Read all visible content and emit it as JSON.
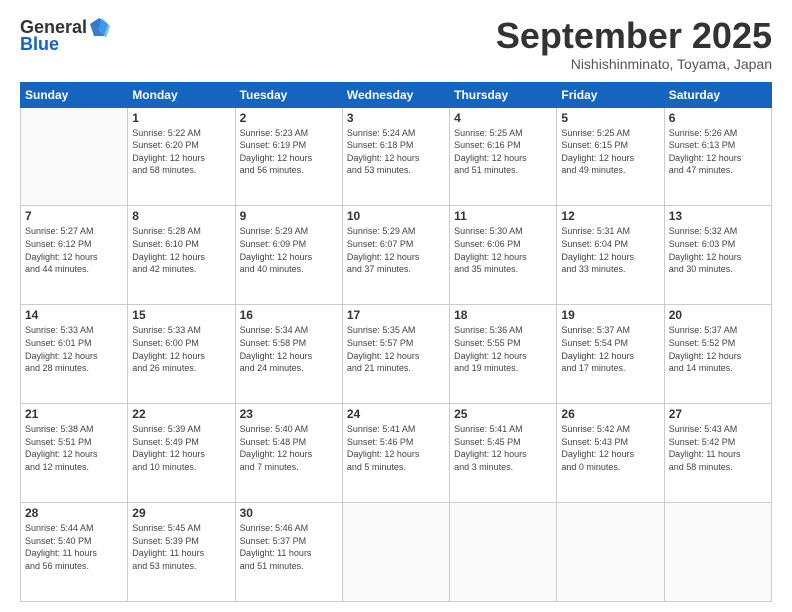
{
  "header": {
    "logo_line1": "General",
    "logo_line2": "Blue",
    "month": "September 2025",
    "location": "Nishishinminato, Toyama, Japan"
  },
  "weekdays": [
    "Sunday",
    "Monday",
    "Tuesday",
    "Wednesday",
    "Thursday",
    "Friday",
    "Saturday"
  ],
  "weeks": [
    [
      {
        "day": "",
        "info": ""
      },
      {
        "day": "1",
        "info": "Sunrise: 5:22 AM\nSunset: 6:20 PM\nDaylight: 12 hours\nand 58 minutes."
      },
      {
        "day": "2",
        "info": "Sunrise: 5:23 AM\nSunset: 6:19 PM\nDaylight: 12 hours\nand 56 minutes."
      },
      {
        "day": "3",
        "info": "Sunrise: 5:24 AM\nSunset: 6:18 PM\nDaylight: 12 hours\nand 53 minutes."
      },
      {
        "day": "4",
        "info": "Sunrise: 5:25 AM\nSunset: 6:16 PM\nDaylight: 12 hours\nand 51 minutes."
      },
      {
        "day": "5",
        "info": "Sunrise: 5:25 AM\nSunset: 6:15 PM\nDaylight: 12 hours\nand 49 minutes."
      },
      {
        "day": "6",
        "info": "Sunrise: 5:26 AM\nSunset: 6:13 PM\nDaylight: 12 hours\nand 47 minutes."
      }
    ],
    [
      {
        "day": "7",
        "info": "Sunrise: 5:27 AM\nSunset: 6:12 PM\nDaylight: 12 hours\nand 44 minutes."
      },
      {
        "day": "8",
        "info": "Sunrise: 5:28 AM\nSunset: 6:10 PM\nDaylight: 12 hours\nand 42 minutes."
      },
      {
        "day": "9",
        "info": "Sunrise: 5:29 AM\nSunset: 6:09 PM\nDaylight: 12 hours\nand 40 minutes."
      },
      {
        "day": "10",
        "info": "Sunrise: 5:29 AM\nSunset: 6:07 PM\nDaylight: 12 hours\nand 37 minutes."
      },
      {
        "day": "11",
        "info": "Sunrise: 5:30 AM\nSunset: 6:06 PM\nDaylight: 12 hours\nand 35 minutes."
      },
      {
        "day": "12",
        "info": "Sunrise: 5:31 AM\nSunset: 6:04 PM\nDaylight: 12 hours\nand 33 minutes."
      },
      {
        "day": "13",
        "info": "Sunrise: 5:32 AM\nSunset: 6:03 PM\nDaylight: 12 hours\nand 30 minutes."
      }
    ],
    [
      {
        "day": "14",
        "info": "Sunrise: 5:33 AM\nSunset: 6:01 PM\nDaylight: 12 hours\nand 28 minutes."
      },
      {
        "day": "15",
        "info": "Sunrise: 5:33 AM\nSunset: 6:00 PM\nDaylight: 12 hours\nand 26 minutes."
      },
      {
        "day": "16",
        "info": "Sunrise: 5:34 AM\nSunset: 5:58 PM\nDaylight: 12 hours\nand 24 minutes."
      },
      {
        "day": "17",
        "info": "Sunrise: 5:35 AM\nSunset: 5:57 PM\nDaylight: 12 hours\nand 21 minutes."
      },
      {
        "day": "18",
        "info": "Sunrise: 5:36 AM\nSunset: 5:55 PM\nDaylight: 12 hours\nand 19 minutes."
      },
      {
        "day": "19",
        "info": "Sunrise: 5:37 AM\nSunset: 5:54 PM\nDaylight: 12 hours\nand 17 minutes."
      },
      {
        "day": "20",
        "info": "Sunrise: 5:37 AM\nSunset: 5:52 PM\nDaylight: 12 hours\nand 14 minutes."
      }
    ],
    [
      {
        "day": "21",
        "info": "Sunrise: 5:38 AM\nSunset: 5:51 PM\nDaylight: 12 hours\nand 12 minutes."
      },
      {
        "day": "22",
        "info": "Sunrise: 5:39 AM\nSunset: 5:49 PM\nDaylight: 12 hours\nand 10 minutes."
      },
      {
        "day": "23",
        "info": "Sunrise: 5:40 AM\nSunset: 5:48 PM\nDaylight: 12 hours\nand 7 minutes."
      },
      {
        "day": "24",
        "info": "Sunrise: 5:41 AM\nSunset: 5:46 PM\nDaylight: 12 hours\nand 5 minutes."
      },
      {
        "day": "25",
        "info": "Sunrise: 5:41 AM\nSunset: 5:45 PM\nDaylight: 12 hours\nand 3 minutes."
      },
      {
        "day": "26",
        "info": "Sunrise: 5:42 AM\nSunset: 5:43 PM\nDaylight: 12 hours\nand 0 minutes."
      },
      {
        "day": "27",
        "info": "Sunrise: 5:43 AM\nSunset: 5:42 PM\nDaylight: 11 hours\nand 58 minutes."
      }
    ],
    [
      {
        "day": "28",
        "info": "Sunrise: 5:44 AM\nSunset: 5:40 PM\nDaylight: 11 hours\nand 56 minutes."
      },
      {
        "day": "29",
        "info": "Sunrise: 5:45 AM\nSunset: 5:39 PM\nDaylight: 11 hours\nand 53 minutes."
      },
      {
        "day": "30",
        "info": "Sunrise: 5:46 AM\nSunset: 5:37 PM\nDaylight: 11 hours\nand 51 minutes."
      },
      {
        "day": "",
        "info": ""
      },
      {
        "day": "",
        "info": ""
      },
      {
        "day": "",
        "info": ""
      },
      {
        "day": "",
        "info": ""
      }
    ]
  ]
}
